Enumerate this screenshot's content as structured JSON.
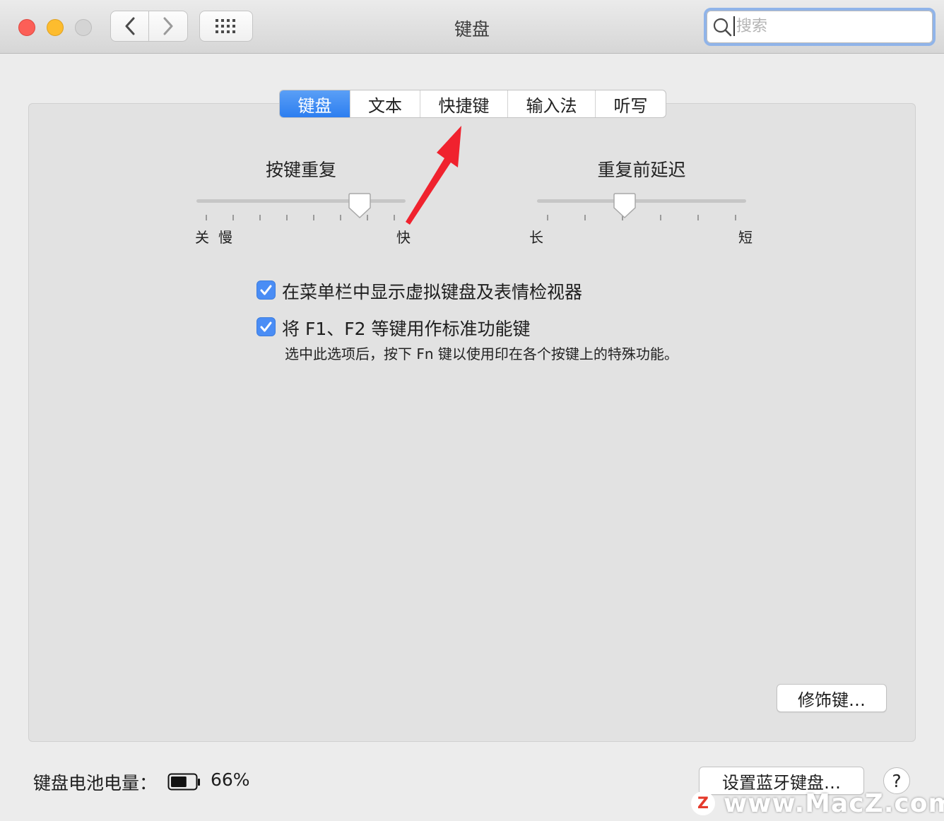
{
  "window": {
    "title": "键盘"
  },
  "search": {
    "placeholder": "搜索",
    "value": ""
  },
  "tabs": [
    {
      "label": "键盘",
      "active": true
    },
    {
      "label": "文本",
      "active": false
    },
    {
      "label": "快捷键",
      "active": false
    },
    {
      "label": "输入法",
      "active": false
    },
    {
      "label": "听写",
      "active": false
    }
  ],
  "key_repeat": {
    "title": "按键重复",
    "label_off": "关",
    "label_slow": "慢",
    "label_fast": "快",
    "level": 0.84
  },
  "delay_until_repeat": {
    "title": "重复前延迟",
    "label_long": "长",
    "label_short": "短",
    "level": 0.4
  },
  "options": {
    "show_viewer": {
      "label": "在菜单栏中显示虚拟键盘及表情检视器",
      "checked": true
    },
    "fn_keys": {
      "label": "将 F1、F2 等键用作标准功能键",
      "checked": true,
      "description": "选中此选项后，按下 Fn 键以使用印在各个按键上的特殊功能。"
    }
  },
  "buttons": {
    "modifier_keys": "修饰键…",
    "setup_bluetooth": "设置蓝牙键盘…",
    "help": "?"
  },
  "battery": {
    "label": "键盘电池电量：",
    "percent": "66%",
    "level": 0.66
  },
  "watermark": {
    "logo": "Z",
    "text": "www.MacZ.com"
  },
  "colors": {
    "accent": "#3b86f3",
    "annotation_arrow": "#f0222e"
  }
}
